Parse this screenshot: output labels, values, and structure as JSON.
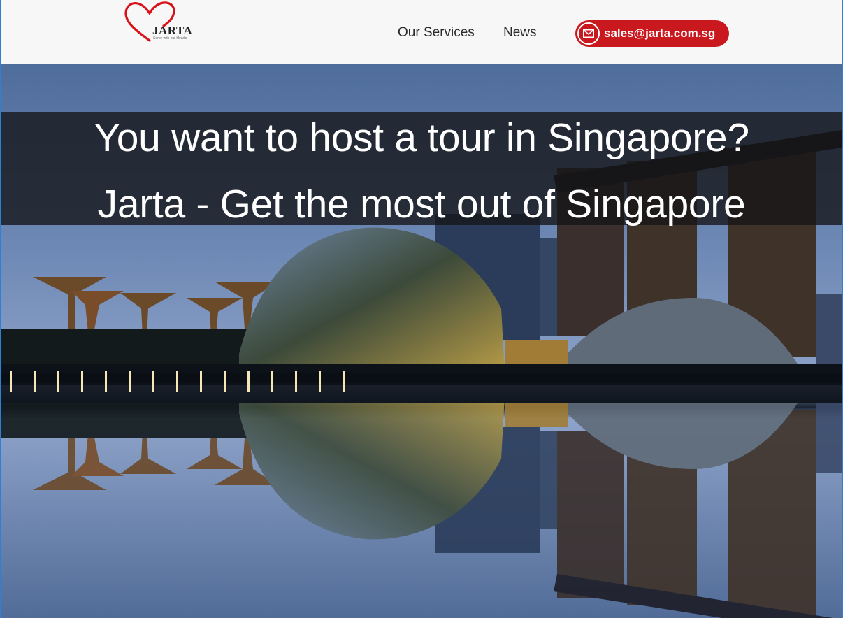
{
  "brand": {
    "name": "JARTA",
    "tagline": "Serve with our Hearts",
    "logo_color": "#d8121b"
  },
  "nav": {
    "items": [
      {
        "label": "Our Services"
      },
      {
        "label": "News"
      }
    ]
  },
  "contact": {
    "email": "sales@jarta.com.sg",
    "icon": "envelope-icon",
    "button_color": "#c9191f"
  },
  "hero": {
    "headline_1": "You want to host a tour in Singapore?",
    "headline_2": "Jarta - Get the most out of Singapore",
    "image": "singapore-gardens-by-the-bay-night-skyline",
    "banner_color": "#141416"
  }
}
